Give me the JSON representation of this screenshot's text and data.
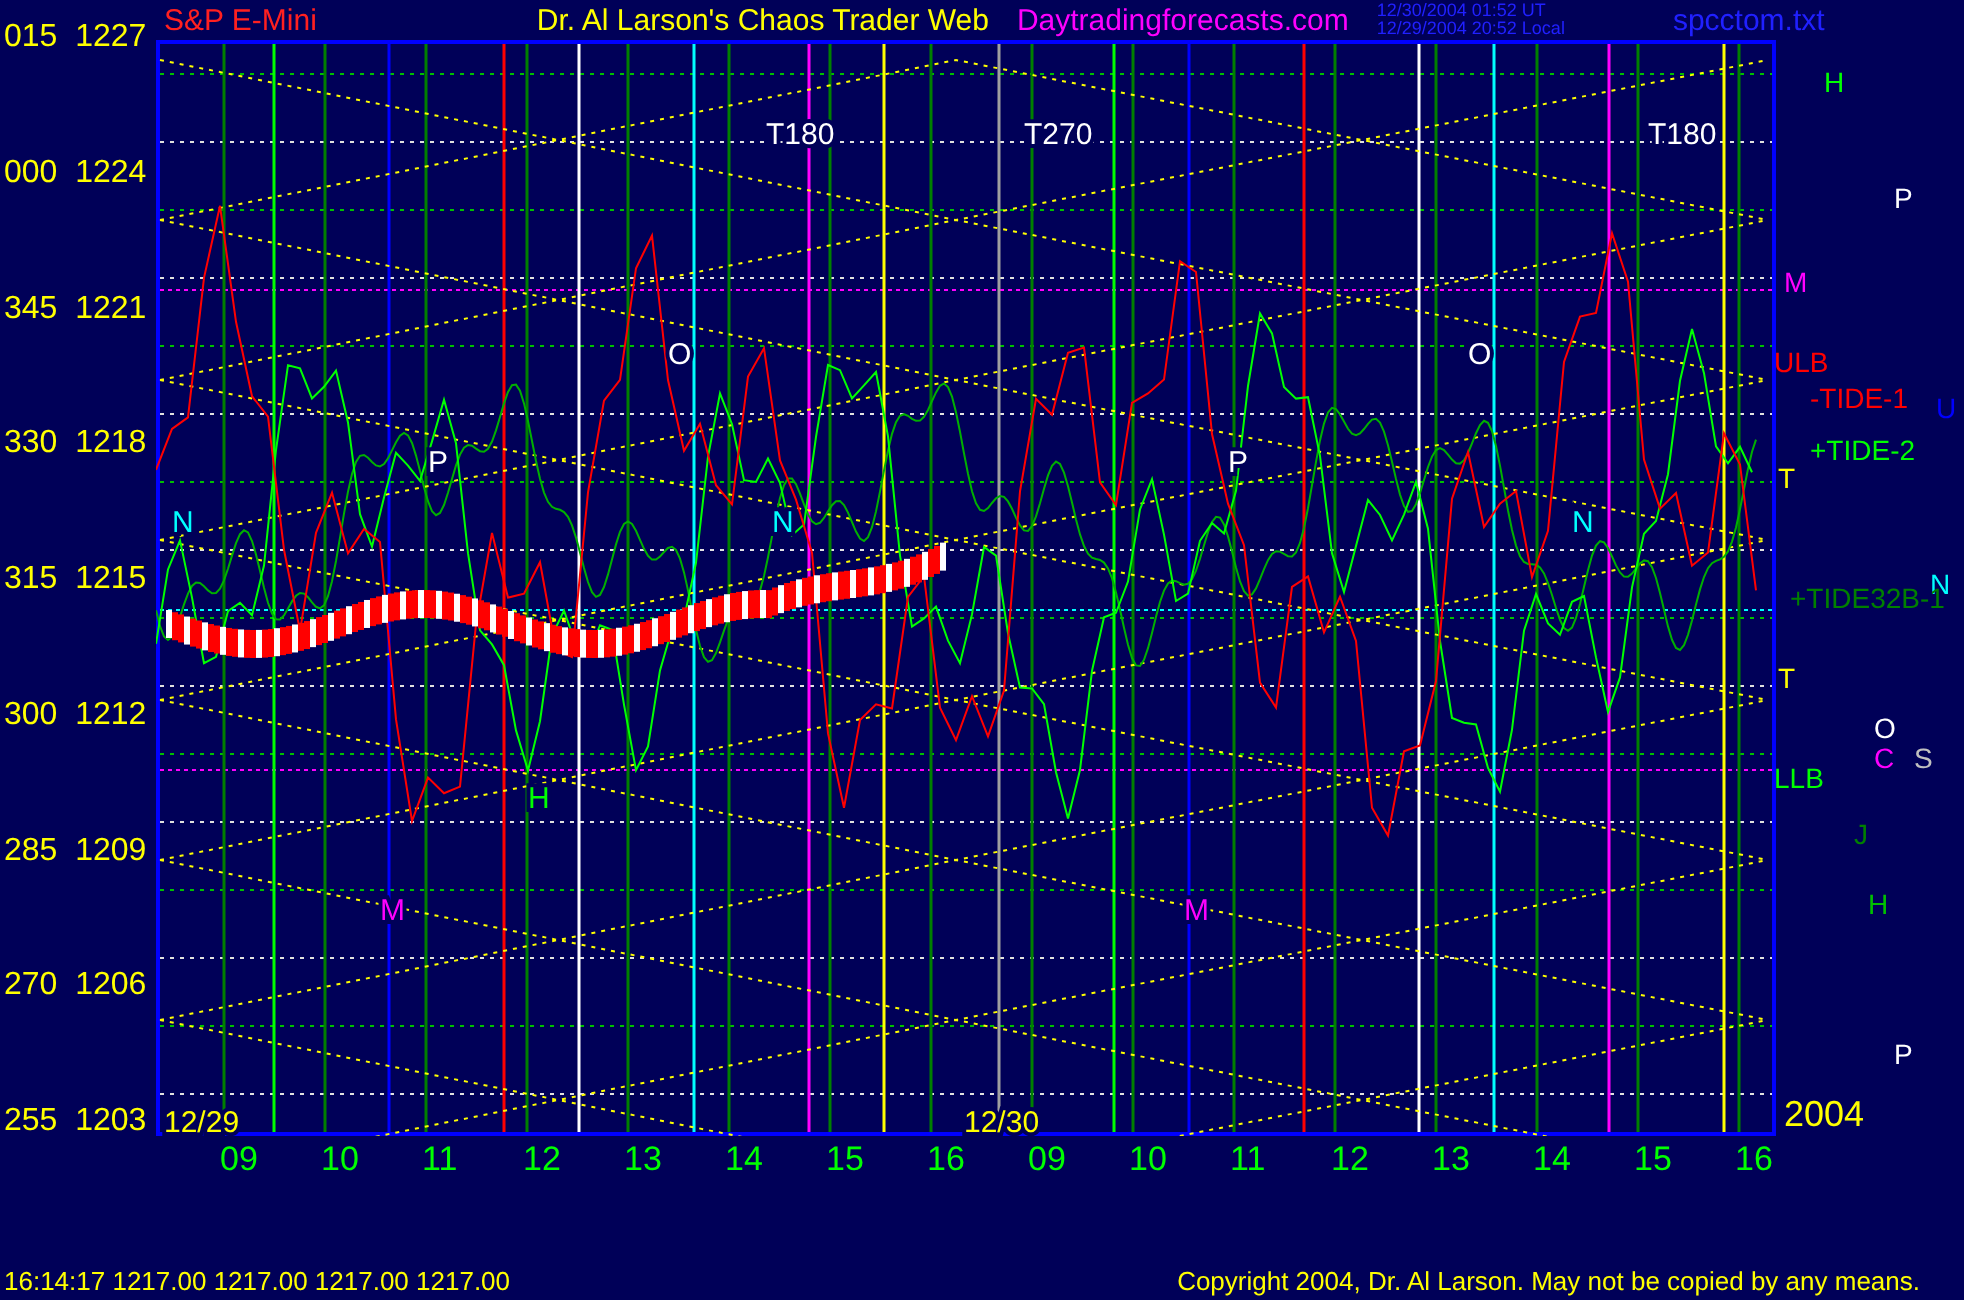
{
  "header": {
    "symbol": "S&P E-Mini",
    "title": "Dr. Al Larson's Chaos Trader Web",
    "site": "Daytradingforecasts.com",
    "time_ut": "12/30/2004 01:52 UT",
    "time_local": "12/29/2004 20:52 Local",
    "file": "spcctom.txt"
  },
  "y_axis": [
    {
      "angle": "015",
      "price": "1227"
    },
    {
      "angle": "000",
      "price": "1224"
    },
    {
      "angle": "345",
      "price": "1221"
    },
    {
      "angle": "330",
      "price": "1218"
    },
    {
      "angle": "315",
      "price": "1215"
    },
    {
      "angle": "300",
      "price": "1212"
    },
    {
      "angle": "285",
      "price": "1209"
    },
    {
      "angle": "270",
      "price": "1206"
    },
    {
      "angle": "255",
      "price": "1203"
    }
  ],
  "x_axis": [
    "09",
    "10",
    "11",
    "12",
    "13",
    "14",
    "15",
    "16",
    "09",
    "10",
    "11",
    "12",
    "13",
    "14",
    "15",
    "16"
  ],
  "chart_labels": [
    {
      "text": "T180",
      "color": "#ffffff"
    },
    {
      "text": "T270",
      "color": "#ffffff"
    },
    {
      "text": "T180",
      "color": "#ffffff"
    },
    {
      "text": "O",
      "color": "#ffffff"
    },
    {
      "text": "O",
      "color": "#ffffff"
    },
    {
      "text": "P",
      "color": "#ffffff"
    },
    {
      "text": "P",
      "color": "#ffffff"
    },
    {
      "text": "N",
      "color": "#00ffff"
    },
    {
      "text": "N",
      "color": "#00ffff"
    },
    {
      "text": "N",
      "color": "#00ffff"
    },
    {
      "text": "H",
      "color": "#00ff00"
    },
    {
      "text": "M",
      "color": "#ff00ff"
    },
    {
      "text": "M",
      "color": "#ff00ff"
    },
    {
      "text": "12/29",
      "color": "#ffff00"
    },
    {
      "text": "12/30",
      "color": "#ffff00"
    }
  ],
  "right_labels": [
    {
      "text": "H",
      "color": "#00ff00"
    },
    {
      "text": "P",
      "color": "#ffffff"
    },
    {
      "text": "M",
      "color": "#ff00ff"
    },
    {
      "text": "ULB",
      "color": "#ff0000"
    },
    {
      "text": "-TIDE-1",
      "color": "#ff0000"
    },
    {
      "text": "U",
      "color": "#0000ff"
    },
    {
      "text": "+TIDE-2",
      "color": "#00ff00"
    },
    {
      "text": "T",
      "color": "#ffff00"
    },
    {
      "text": "N",
      "color": "#00ffff"
    },
    {
      "text": "+TIDE32B-1",
      "color": "#008000"
    },
    {
      "text": "T",
      "color": "#ffff00"
    },
    {
      "text": "O",
      "color": "#ffffff"
    },
    {
      "text": "C",
      "color": "#ff00ff"
    },
    {
      "text": "S",
      "color": "#c0c0c0"
    },
    {
      "text": "LLB",
      "color": "#00ff00"
    },
    {
      "text": "J",
      "color": "#008000"
    },
    {
      "text": "H",
      "color": "#00c000"
    },
    {
      "text": "P",
      "color": "#ffffff"
    },
    {
      "text": "2004",
      "color": "#ffff00"
    }
  ],
  "footer": {
    "quote": "16:14:17  1217.00 1217.00 1217.00 1217.00",
    "copyright": "Copyright 2004, Dr. Al Larson. May not be copied by any means."
  }
}
